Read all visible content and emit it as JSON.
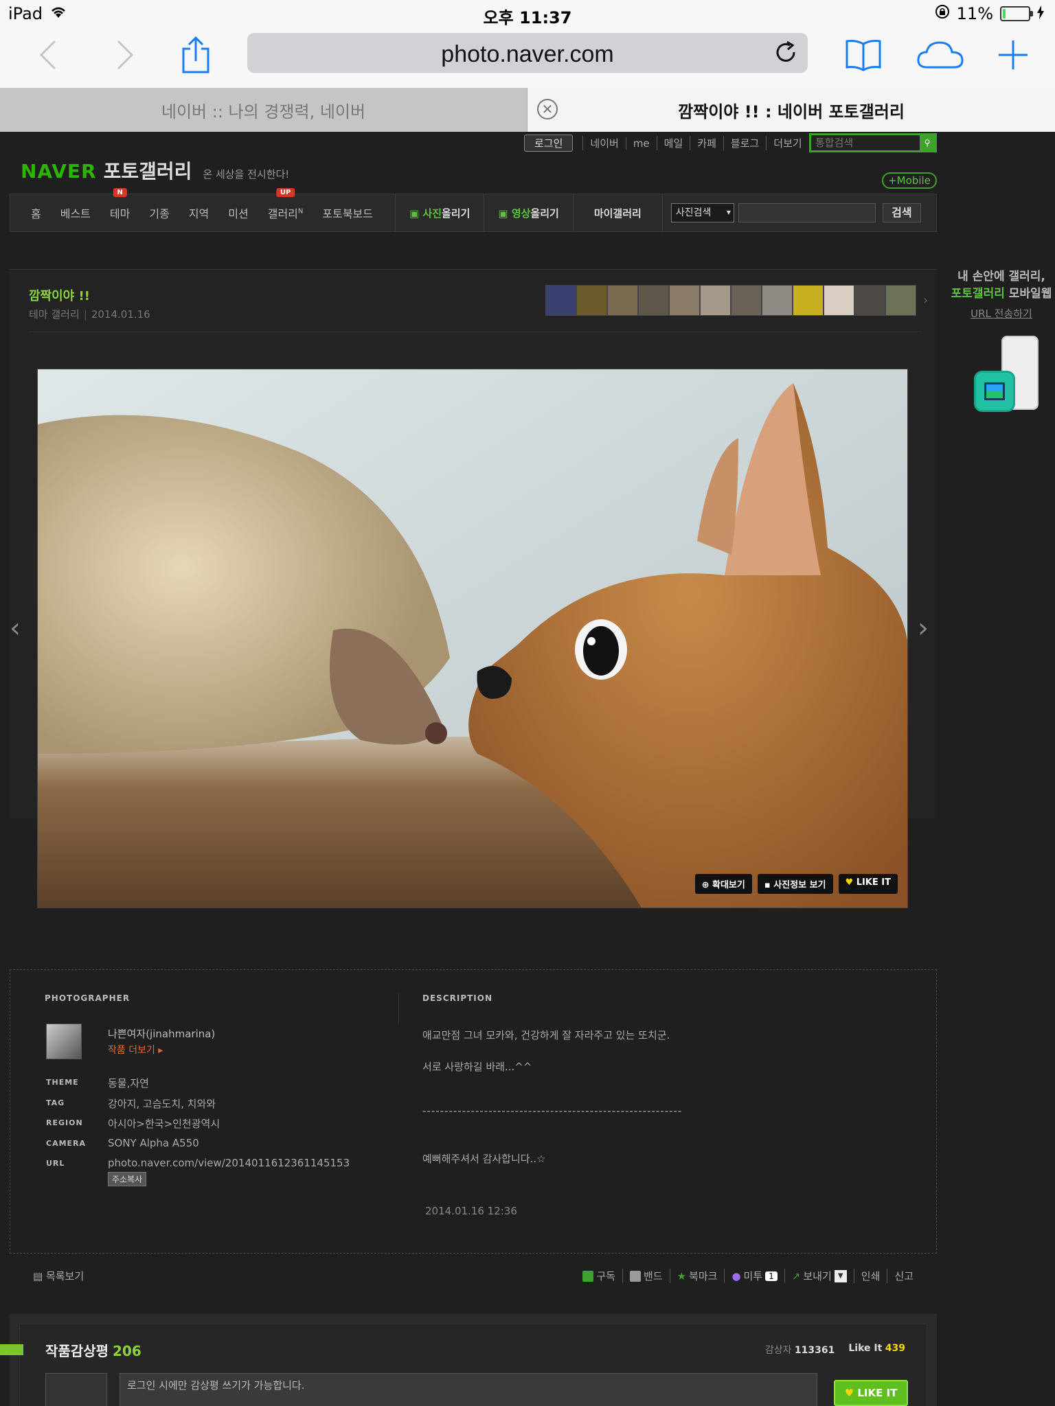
{
  "status": {
    "device": "iPad",
    "time": "오후 11:37",
    "battery": "11%",
    "battery_level": 0.11
  },
  "browser": {
    "url": "photo.naver.com",
    "tabs": [
      {
        "label": "네이버 :: 나의 경쟁력, 네이버"
      },
      {
        "label": "깜짝이야 !! : 네이버 포토갤러리"
      }
    ]
  },
  "header": {
    "login": "로그인",
    "links": [
      "네이버",
      "me",
      "메일",
      "카페",
      "블로그",
      "더보기"
    ],
    "search_placeholder": "통합검색",
    "logo_naver": "NAVER",
    "logo_gallery": "포토갤러리",
    "slogan": "온 세상을 전시한다!",
    "mobile": "+Mobile"
  },
  "gnb": {
    "items": [
      "홈",
      "베스트",
      "테마",
      "기종",
      "지역",
      "미션",
      "갤러리",
      "포토북보드"
    ],
    "gallery_sup": "N",
    "badge_theme": "N",
    "badge_gallery": "UP",
    "upload_photo_1": "사진",
    "upload_photo_2": "올리기",
    "upload_video_1": "영상",
    "upload_video_2": "올리기",
    "my_gallery": "마이갤러리",
    "search_select": "사진검색",
    "search_button": "검색"
  },
  "album": {
    "title": "깜짝이야 !!",
    "category": "테마 갤러리",
    "date": "2014.01.16"
  },
  "photo_buttons": {
    "zoom": "확대보기",
    "info": "사진정보 보기",
    "like": "LIKE IT"
  },
  "side_ad": {
    "line1": "내 손안에 갤러리,",
    "line2_green": "포토갤러리",
    "line2_rest": " 모바일웹",
    "link": "URL 전송하기"
  },
  "info": {
    "photographer_h": "PHOTOGRAPHER",
    "description_h": "DESCRIPTION",
    "photographer": "나쁜여자(jinahmarina)",
    "more_works": "작품 더보기 ▸",
    "theme_k": "THEME",
    "theme_v": "동물,자연",
    "tag_k": "TAG",
    "tag_v": "강아지, 고슴도치, 치와와",
    "region_k": "REGION",
    "region_v": "아시아>한국>인천광역시",
    "camera_k": "CAMERA",
    "camera_v": "SONY Alpha A550",
    "url_k": "URL",
    "url_v": "photo.naver.com/view/2014011612361145153",
    "copy": "주소복사",
    "desc1": "애교만점 그녀 모카와, 건강하게 잘 자라주고 있는 또치군.",
    "desc2": "서로 사랑하길 바래...^^",
    "desc3": "-----------------------------------------------------------",
    "desc4": "예뻐해주셔서 감사합니다..☆",
    "desc_date": "2014.01.16 12:36"
  },
  "actions": {
    "list": "목록보기",
    "subscribe": "구독",
    "band": "밴드",
    "bookmark": "북마크",
    "metoo": "미투",
    "metoo_count": "1",
    "send": "보내기",
    "print": "인쇄",
    "report": "신고"
  },
  "comments": {
    "title": "작품감상평",
    "count": "206",
    "viewers_label": "감상자",
    "viewers": "113361",
    "likes_label": "Like It",
    "likes": "439",
    "placeholder": "로그인 시에만 감상평 쓰기가 가능합니다.",
    "like_btn": "LIKE IT"
  },
  "colors": {
    "accent": "#5ac53a",
    "badge": "#d9362b",
    "like_yellow": "#f7d600",
    "more_orange": "#e36a2c"
  }
}
